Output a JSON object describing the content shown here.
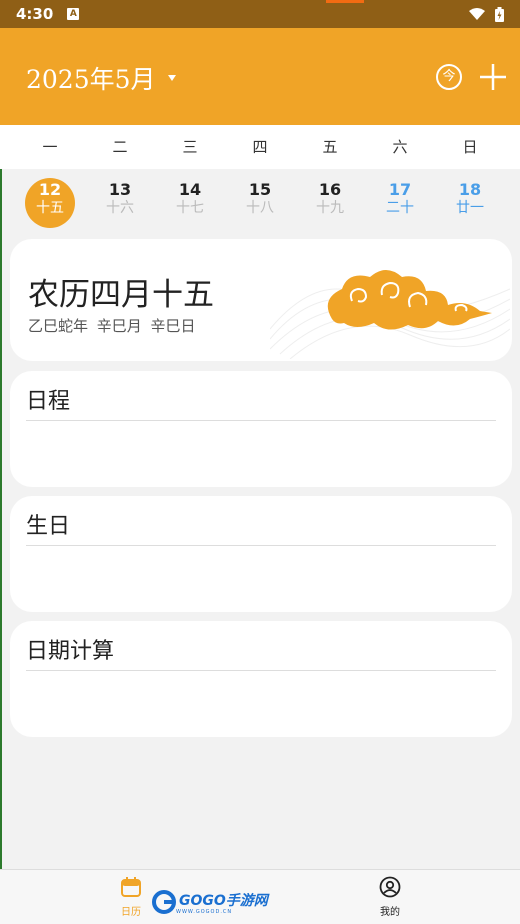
{
  "status_bar": {
    "time": "4:30",
    "notification": "A"
  },
  "header": {
    "title": "2025年5月",
    "today_label": "今"
  },
  "weekdays": [
    "一",
    "二",
    "三",
    "四",
    "五",
    "六",
    "日"
  ],
  "days": [
    {
      "num": "12",
      "lunar": "十五",
      "selected": true,
      "weekend": false
    },
    {
      "num": "13",
      "lunar": "十六",
      "selected": false,
      "weekend": false
    },
    {
      "num": "14",
      "lunar": "十七",
      "selected": false,
      "weekend": false
    },
    {
      "num": "15",
      "lunar": "十八",
      "selected": false,
      "weekend": false
    },
    {
      "num": "16",
      "lunar": "十九",
      "selected": false,
      "weekend": false
    },
    {
      "num": "17",
      "lunar": "二十",
      "selected": false,
      "weekend": true
    },
    {
      "num": "18",
      "lunar": "廿一",
      "selected": false,
      "weekend": true
    }
  ],
  "lunar_card": {
    "date": "农历四月十五",
    "ganzhi": "乙巳蛇年 辛巳月 辛巳日"
  },
  "sections": [
    {
      "heading": "日程"
    },
    {
      "heading": "生日"
    },
    {
      "heading": "日期计算"
    }
  ],
  "tabbar": {
    "calendar": "日历",
    "me": "我的"
  },
  "watermark": {
    "brand": "GOGO手游网",
    "url": "WWW.GOGOD.CN"
  },
  "colors": {
    "accent": "#f0a427",
    "weekend": "#4a9ee8",
    "status_bar": "#8f5f16"
  }
}
